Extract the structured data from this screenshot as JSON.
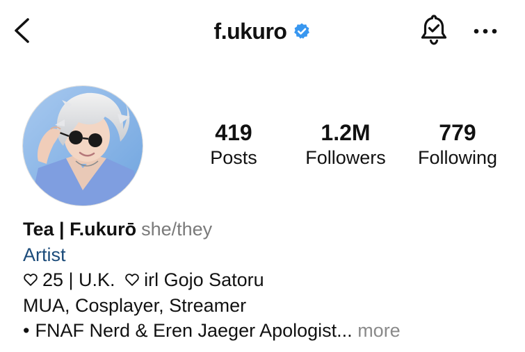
{
  "header": {
    "username": "f.ukuro",
    "verified": true,
    "back_icon": "chevron-left-icon",
    "bell_icon": "bell-check-icon",
    "more_icon": "more-horizontal-icon",
    "verified_color": "#3897f0"
  },
  "stats": {
    "posts": {
      "value": "419",
      "label": "Posts"
    },
    "followers": {
      "value": "1.2M",
      "label": "Followers"
    },
    "following": {
      "value": "779",
      "label": "Following"
    }
  },
  "bio": {
    "name": "Tea | F.ukurō",
    "pronouns": "she/they",
    "category": "Artist",
    "line1_part1": "25 | U.K.",
    "line1_part2": "irl Gojo Satoru",
    "line2": "MUA, Cosplayer, Streamer",
    "line3_bullet": "•",
    "line3": "FNAF Nerd & Eren Jaeger Apologist...",
    "more_label": "more",
    "heart_icon": "heart-outline-icon"
  },
  "colors": {
    "category": "#1b4b7a",
    "secondary_text": "#7a7a7a"
  }
}
